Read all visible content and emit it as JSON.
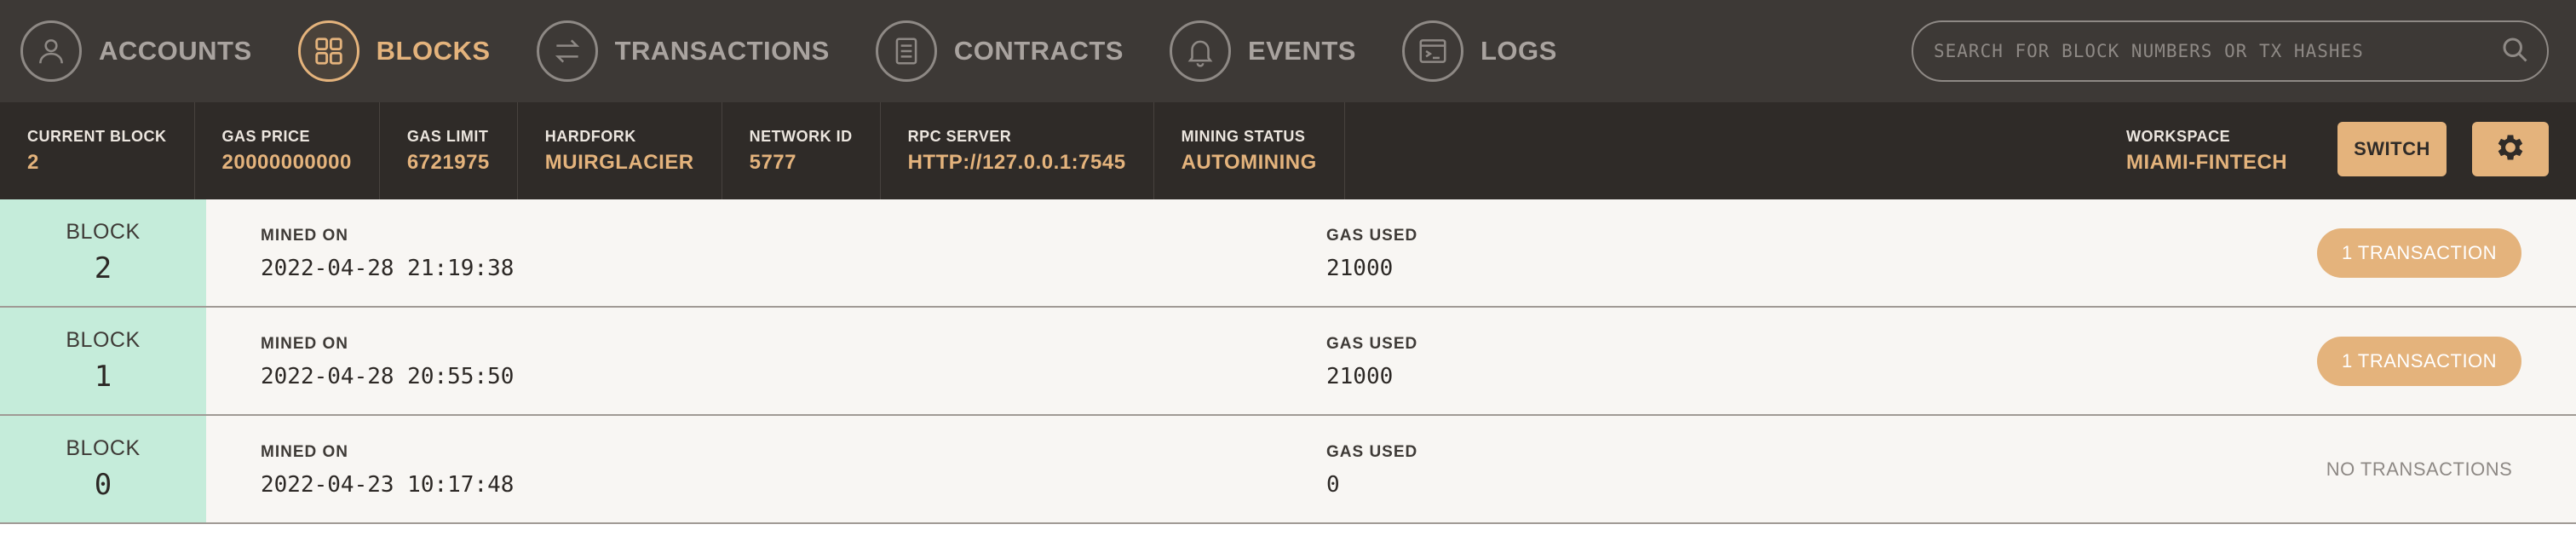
{
  "nav": {
    "items": [
      {
        "label": "ACCOUNTS",
        "icon": "user-icon",
        "active": false
      },
      {
        "label": "BLOCKS",
        "icon": "blocks-grid-icon",
        "active": true
      },
      {
        "label": "TRANSACTIONS",
        "icon": "transfer-arrows-icon",
        "active": false
      },
      {
        "label": "CONTRACTS",
        "icon": "document-icon",
        "active": false
      },
      {
        "label": "EVENTS",
        "icon": "bell-icon",
        "active": false
      },
      {
        "label": "LOGS",
        "icon": "terminal-icon",
        "active": false
      }
    ]
  },
  "search": {
    "placeholder": "SEARCH FOR BLOCK NUMBERS OR TX HASHES",
    "value": ""
  },
  "status": {
    "current_block": {
      "label": "CURRENT BLOCK",
      "value": "2"
    },
    "gas_price": {
      "label": "GAS PRICE",
      "value": "20000000000"
    },
    "gas_limit": {
      "label": "GAS LIMIT",
      "value": "6721975"
    },
    "hardfork": {
      "label": "HARDFORK",
      "value": "MUIRGLACIER"
    },
    "network_id": {
      "label": "NETWORK ID",
      "value": "5777"
    },
    "rpc_server": {
      "label": "RPC SERVER",
      "value": "HTTP://127.0.0.1:7545"
    },
    "mining_status": {
      "label": "MINING STATUS",
      "value": "AUTOMINING"
    },
    "workspace": {
      "label": "WORKSPACE",
      "value": "MIAMI-FINTECH"
    },
    "switch_label": "SWITCH"
  },
  "blocks": {
    "block_label": "BLOCK",
    "mined_on_label": "MINED ON",
    "gas_used_label": "GAS USED",
    "rows": [
      {
        "number": "2",
        "mined_on": "2022-04-28 21:19:38",
        "gas_used": "21000",
        "tx": "1 TRANSACTION"
      },
      {
        "number": "1",
        "mined_on": "2022-04-28 20:55:50",
        "gas_used": "21000",
        "tx": "1 TRANSACTION"
      },
      {
        "number": "0",
        "mined_on": "2022-04-23 10:17:48",
        "gas_used": "0",
        "tx": "NO TRANSACTIONS"
      }
    ]
  },
  "colors": {
    "accent": "#e4b37c",
    "nav_bg": "#3d3936",
    "status_bg": "#2f2b28",
    "block_number_bg": "#c5ecda",
    "row_bg": "#f8f6f3"
  }
}
